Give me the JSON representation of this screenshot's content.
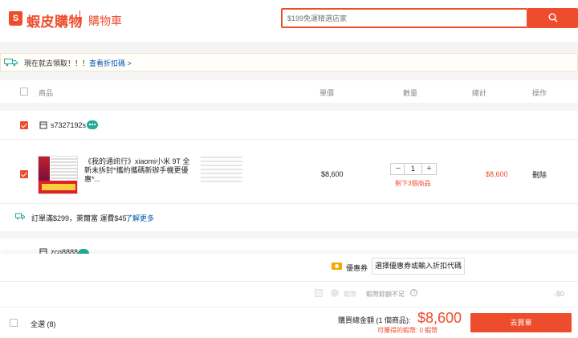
{
  "header": {
    "logo_glyph": "S",
    "logo_text": "蝦皮購物",
    "page_title": "購物車",
    "search_placeholder": "$199免運精選店家"
  },
  "banner": {
    "text": "現在就去領取！！！",
    "link": "查看折扣碼 >"
  },
  "table_header": {
    "product": "商品",
    "unit_price": "單價",
    "quantity": "數量",
    "total": "總計",
    "actions": "操作"
  },
  "shops": [
    {
      "name": "s7327192s",
      "items": [
        {
          "name": "《我的通訊行》xiaomi小米 9T 全新未拆封*攜約攜碼新辦手機更優惠*...",
          "unit_price": "$8,600",
          "quantity": "1",
          "stock_note": "剩下3個商品",
          "total": "$8,600",
          "delete": "刪除",
          "checked": true
        }
      ],
      "shipping": {
        "text": "訂單滿$299，萊爾富 運費$45",
        "link": "了解更多"
      }
    },
    {
      "name": "zcq8888"
    }
  ],
  "footer": {
    "voucher_label": "優惠券",
    "voucher_button": "選擇優惠券或輸入折扣代碼",
    "coin_label": "蝦幣",
    "coin_note": "蝦幣餘額不足",
    "coin_amount": "-$0",
    "select_all": "全選 (8)",
    "total_label": "購買總金額 (1 個商品):",
    "total_amount": "$8,600",
    "coins_earn": "可獲得的蝦幣: 0 蝦幣",
    "checkout": "去買單"
  },
  "colors": {
    "brand": "#ee4d2d",
    "chat": "#26aa99",
    "link": "#0055aa"
  }
}
